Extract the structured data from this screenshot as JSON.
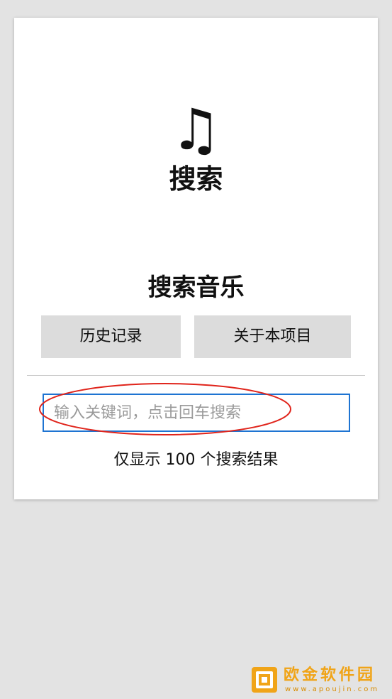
{
  "header": {
    "icon": "music-note-icon",
    "icon_glyph": "♫",
    "title": "搜索"
  },
  "main": {
    "section_title": "搜索音乐",
    "buttons": {
      "history_label": "历史记录",
      "about_label": "关于本项目"
    },
    "search": {
      "placeholder": "输入关键词，点击回车搜索",
      "value": ""
    },
    "result_note": "仅显示 100 个搜索结果"
  },
  "annotation": {
    "type": "red-ellipse-highlight",
    "target": "search-input",
    "color": "#e0241b"
  },
  "watermark": {
    "name": "欧金软件园",
    "url": "www.apoujin.com",
    "color": "#f0a418"
  },
  "colors": {
    "background": "#e3e3e3",
    "card": "#ffffff",
    "button": "#dcdcdc",
    "input_border": "#1e74d2"
  }
}
